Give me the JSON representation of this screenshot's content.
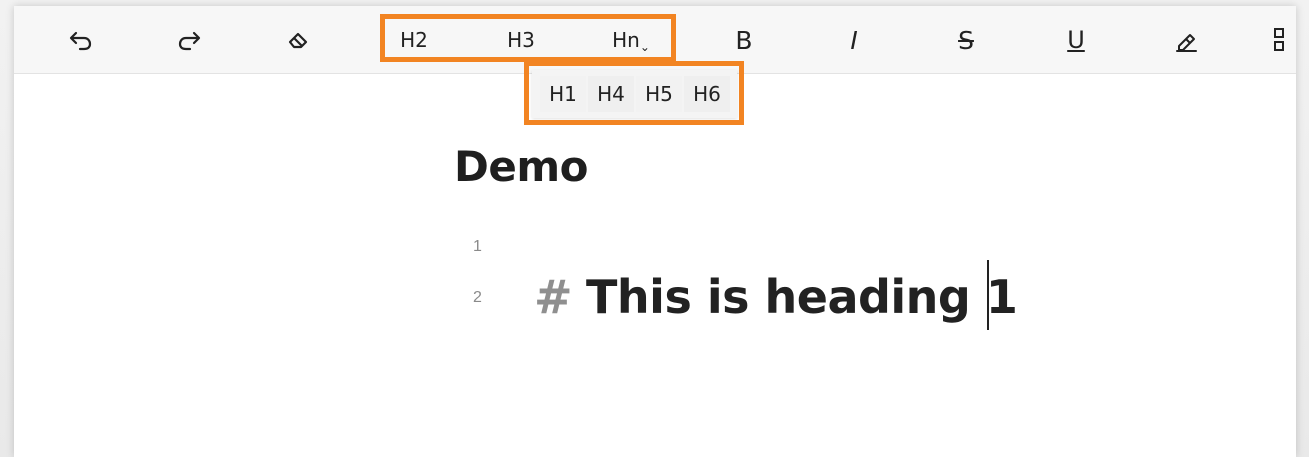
{
  "toolbar": {
    "undo_icon": "undo-icon",
    "redo_icon": "redo-icon",
    "eraser_icon": "eraser-icon",
    "h2_label": "H2",
    "h3_label": "H3",
    "hn_label": "Hn",
    "bold_label": "B",
    "italic_label": "I",
    "strike_label": "S",
    "underline_label": "U",
    "highlight_icon": "highlight-icon",
    "more_icon": "more-icon"
  },
  "heading_submenu": {
    "items": [
      "H1",
      "H4",
      "H5",
      "H6"
    ]
  },
  "document": {
    "title": "Demo",
    "lines": [
      {
        "number": "1",
        "hash": "",
        "text": ""
      },
      {
        "number": "2",
        "hash": "#",
        "text": "This is heading 1"
      }
    ]
  },
  "colors": {
    "highlight_border": "#f28422",
    "toolbar_background": "#f7f7f7",
    "text": "#222222",
    "muted_text": "#8f8f8f"
  }
}
